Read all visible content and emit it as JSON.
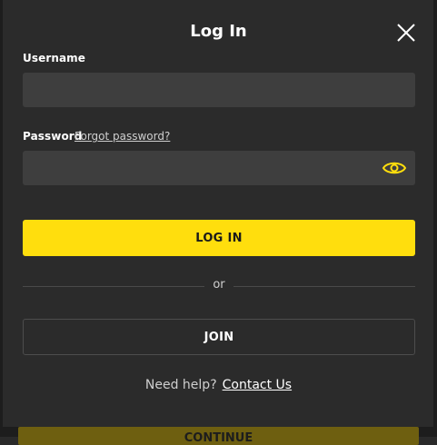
{
  "modal": {
    "title": "Log In",
    "close_icon": "close-icon"
  },
  "form": {
    "username_label": "Username",
    "username_value": "",
    "password_label": "Password",
    "forgot_password": "Forgot password?",
    "password_value": "",
    "eye_icon": "eye-icon",
    "login_label": "LOG IN",
    "divider_text": "or",
    "join_label": "JOIN"
  },
  "help": {
    "text": "Need help?",
    "link": "Contact Us"
  },
  "background": {
    "button_label": "CONTINUE"
  },
  "colors": {
    "accent": "#ffde0d",
    "modal_bg": "#2b2b2b",
    "input_bg": "#3e3e3e"
  }
}
